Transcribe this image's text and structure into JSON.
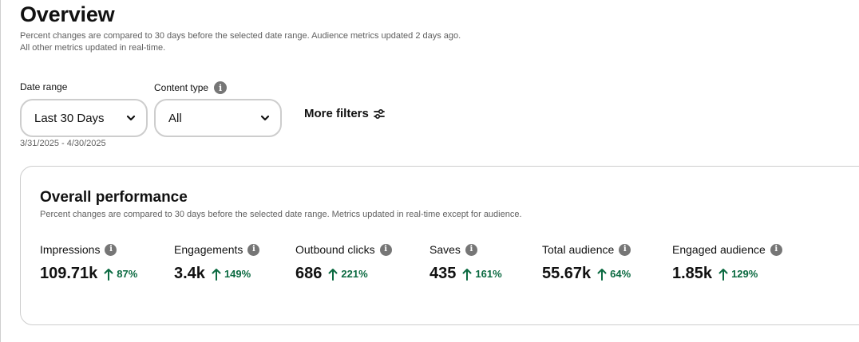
{
  "header": {
    "title": "Overview",
    "subtitle": "Percent changes are compared to 30 days before the selected date range. Audience metrics updated 2 days ago. All other metrics updated in real-time."
  },
  "filters": {
    "date_range": {
      "label": "Date range",
      "value": "Last 30 Days",
      "hint": "3/31/2025 - 4/30/2025"
    },
    "content_type": {
      "label": "Content type",
      "value": "All"
    },
    "more_filters_label": "More filters"
  },
  "performance": {
    "title": "Overall performance",
    "subtitle": "Percent changes are compared to 30 days before the selected date range. Metrics updated in real-time except for audience.",
    "metrics": [
      {
        "label": "Impressions",
        "value": "109.71k",
        "change": "87%"
      },
      {
        "label": "Engagements",
        "value": "3.4k",
        "change": "149%"
      },
      {
        "label": "Outbound clicks",
        "value": "686",
        "change": "221%"
      },
      {
        "label": "Saves",
        "value": "435",
        "change": "161%"
      },
      {
        "label": "Total audience",
        "value": "55.67k",
        "change": "64%"
      },
      {
        "label": "Engaged audience",
        "value": "1.85k",
        "change": "129%"
      }
    ]
  },
  "icons": {
    "info": "info-icon",
    "chevron": "chevron-down-icon",
    "filter": "filter-sliders-icon",
    "trend": "arrow-up-icon"
  },
  "colors": {
    "positive_change": "#0b6a41",
    "info_icon_bg": "#767676",
    "border": "#cdcdcd",
    "muted_text": "#5f5f5f"
  }
}
